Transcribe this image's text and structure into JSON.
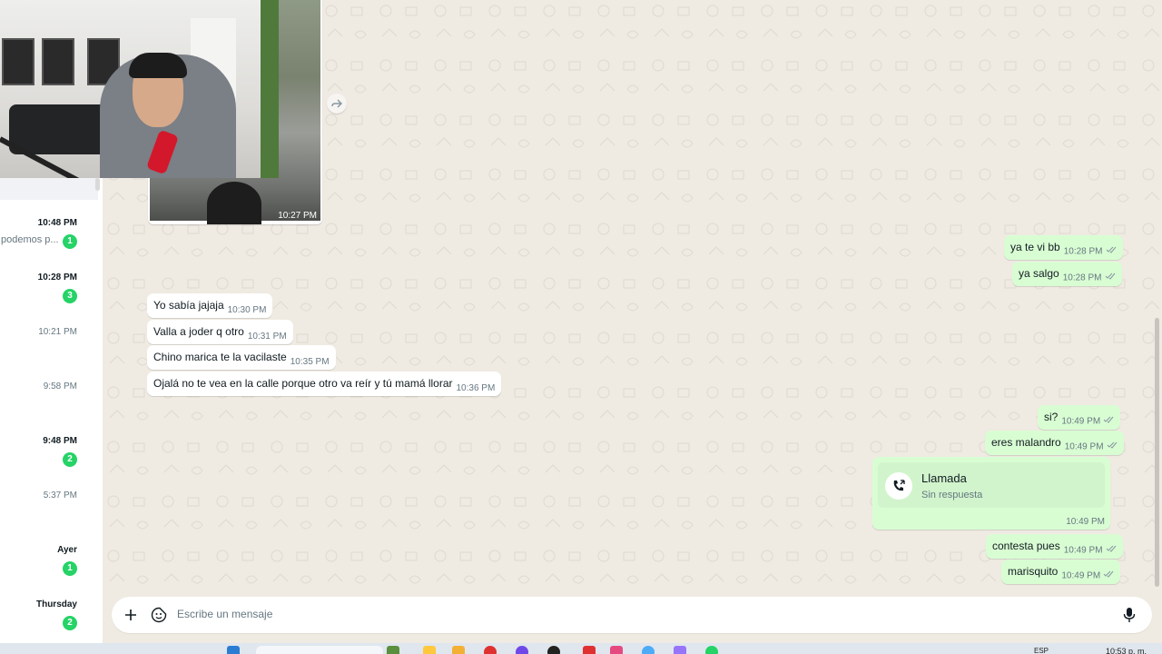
{
  "sidebar": {
    "chats": [
      {
        "time": "10:48 PM",
        "preview": "podemos p...",
        "unread": "1"
      },
      {
        "time": "10:28 PM",
        "preview": "",
        "unread": "3"
      },
      {
        "time": "10:21 PM",
        "preview": "",
        "unread": ""
      },
      {
        "time": "9:58 PM",
        "preview": "",
        "unread": ""
      },
      {
        "time": "9:48 PM",
        "preview": "",
        "unread": "2"
      },
      {
        "time": "5:37 PM",
        "preview": "",
        "unread": ""
      },
      {
        "time": "Ayer",
        "preview": "",
        "unread": "1"
      },
      {
        "time": "Thursday",
        "preview": "",
        "unread": "2"
      }
    ]
  },
  "image_message": {
    "time": "10:27 PM"
  },
  "messages": {
    "out1": {
      "text": "ya te vi bb",
      "time": "10:28 PM"
    },
    "out2": {
      "text": "ya salgo",
      "time": "10:28 PM"
    },
    "in1": {
      "text": "Yo sabía jajaja",
      "time": "10:30 PM"
    },
    "in2": {
      "text": "Valla a joder q otro",
      "time": "10:31 PM"
    },
    "in3": {
      "text": "Chino marica te la vacilaste",
      "time": "10:35 PM"
    },
    "in4": {
      "text": "Ojalá no te vea en la calle porque otro va reír y tú mamá llorar",
      "time": "10:36 PM"
    },
    "out3": {
      "text": "si?",
      "time": "10:49 PM"
    },
    "out4": {
      "text": "eres malandro",
      "time": "10:49 PM"
    },
    "out5": {
      "text": "contesta pues",
      "time": "10:49 PM"
    },
    "out6": {
      "text": "marisquito",
      "time": "10:49 PM"
    }
  },
  "call": {
    "title": "Llamada",
    "subtitle": "Sin respuesta",
    "time": "10:49 PM"
  },
  "composer": {
    "placeholder": "Escribe un mensaje"
  },
  "taskbar": {
    "lang": "ESP",
    "clock": "10:53 p. m."
  },
  "colors": {
    "outgoing_bubble": "#d9fdd3",
    "incoming_bubble": "#ffffff",
    "unread_badge": "#25d366",
    "chat_background": "#efeae2",
    "read_ticks": "#53bdeb"
  }
}
